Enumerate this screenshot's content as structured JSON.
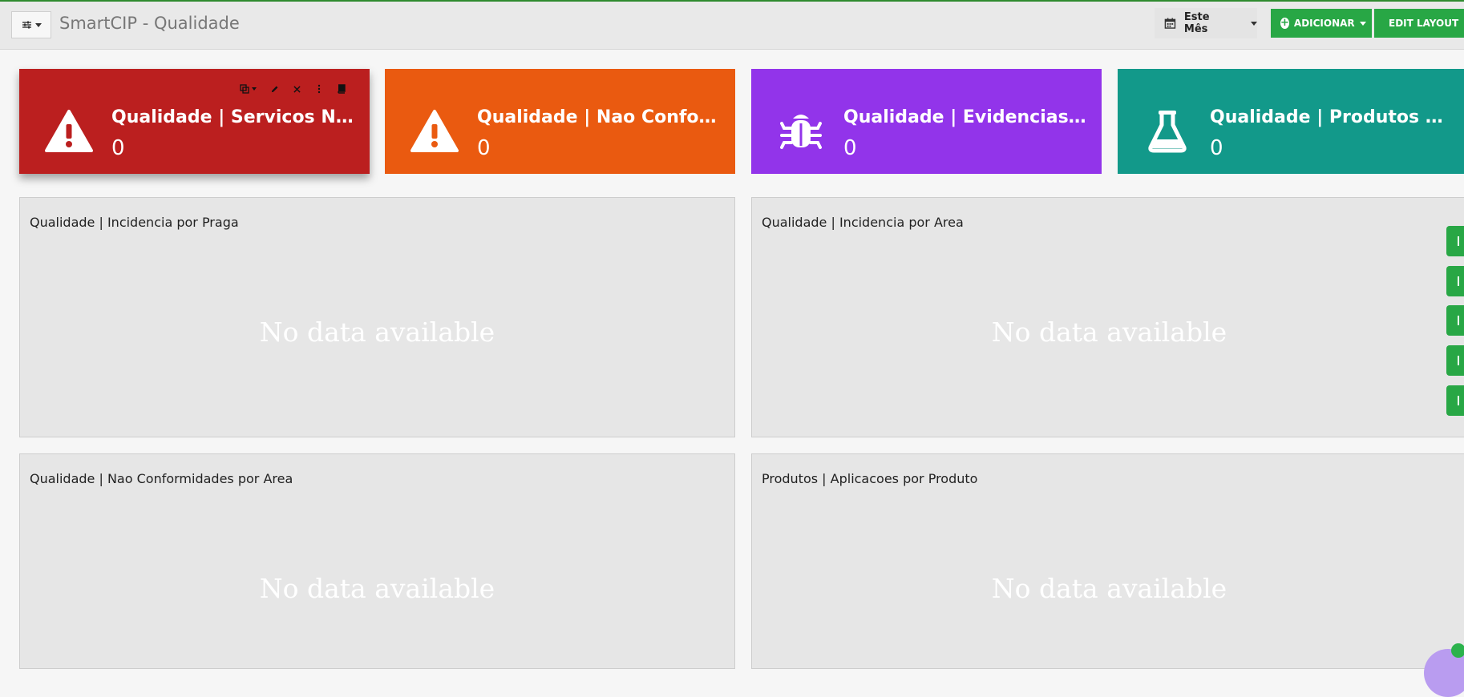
{
  "header": {
    "title": "SmartCIP - Qualidade",
    "period_label": "Este Mês",
    "add_label": "ADICIONAR",
    "edit_label": "EDIT LAYOUT"
  },
  "cards": [
    {
      "title": "Qualidade | Servicos Nao R…",
      "value": "0",
      "color": "#bb1f1f",
      "icon": "warning-icon"
    },
    {
      "title": "Qualidade | Nao Conformid…",
      "value": "0",
      "color": "#ea5a10",
      "icon": "warning-icon"
    },
    {
      "title": "Qualidade | Evidencias Regi…",
      "value": "0",
      "color": "#9234ea",
      "icon": "bug-icon"
    },
    {
      "title": "Qualidade | Produtos Aplica…",
      "value": "0",
      "color": "#12998a",
      "icon": "flask-icon"
    }
  ],
  "panels": [
    {
      "title": "Qualidade | Incidencia por Praga",
      "message": "No data available"
    },
    {
      "title": "Qualidade | Incidencia por Area",
      "message": "No data available"
    },
    {
      "title": "Qualidade | Nao Conformidades por Area",
      "message": "No data available"
    },
    {
      "title": "Produtos | Aplicacoes por Produto",
      "message": "No data available"
    }
  ],
  "colors": {
    "accent_green": "#28a745",
    "top_border": "#2e8b2e"
  }
}
